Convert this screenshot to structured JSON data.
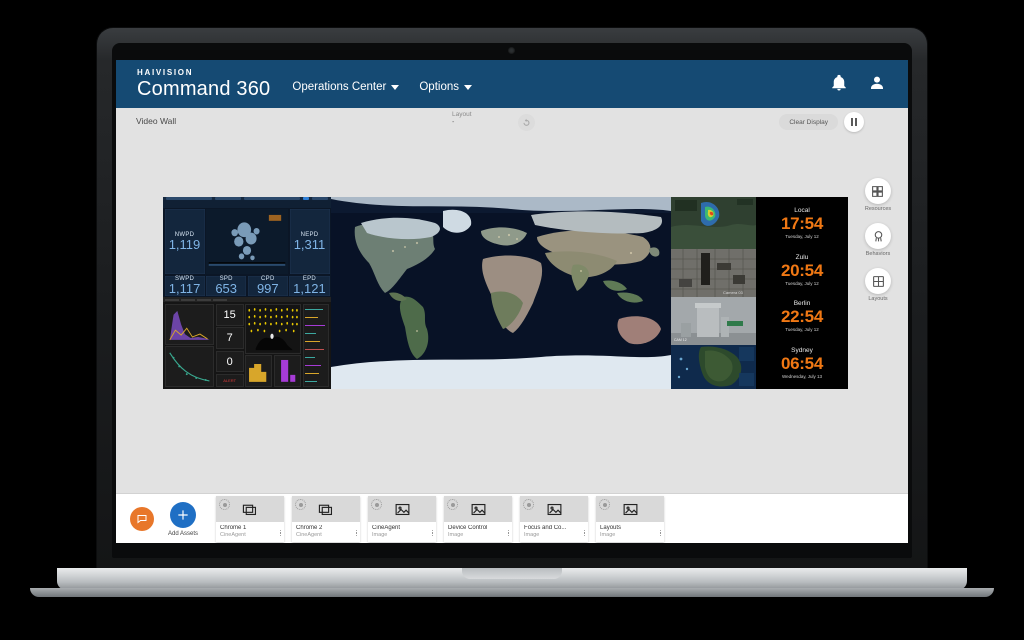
{
  "header": {
    "brand_top": "HAIVISION",
    "brand_main": "Command 360",
    "nav": [
      {
        "label": "Operations Center",
        "icon": "chevron-down-icon"
      },
      {
        "label": "Options",
        "icon": "chevron-down-icon"
      }
    ],
    "notifications_icon": "bell-icon",
    "account_icon": "user-icon"
  },
  "toolbar": {
    "title": "Video Wall",
    "layout_label": "Layout",
    "layout_value": "-",
    "refresh_icon": "refresh-icon",
    "clear_display_label": "Clear Display",
    "pause_icon": "pause-icon"
  },
  "rail": {
    "items": [
      {
        "label": "Resources",
        "icon": "resources-grid-icon"
      },
      {
        "label": "Behaviors",
        "icon": "behaviors-icon"
      },
      {
        "label": "Layouts",
        "icon": "layouts-grid-icon"
      }
    ]
  },
  "wall": {
    "dashboard": {
      "metrics": [
        {
          "label": "NWPD",
          "value": "1,119"
        },
        {
          "label": "NEPD",
          "value": "1,311"
        },
        {
          "label": "SWPD",
          "value": "1,117"
        },
        {
          "label": "SPD",
          "value": "653"
        },
        {
          "label": "CPD",
          "value": "997"
        },
        {
          "label": "EPD",
          "value": "1,121"
        }
      ],
      "analytics_numbers": [
        "15",
        "7",
        "0"
      ]
    },
    "map": {
      "description": "satellite world map"
    },
    "feeds": [
      {
        "name": "weather-radar-feed"
      },
      {
        "name": "aerial-grayscale-feed"
      },
      {
        "name": "building-camera-feed"
      },
      {
        "name": "regional-map-feed"
      }
    ],
    "clocks": [
      {
        "city": "Local",
        "time": "17:54",
        "date": "Tuesday, July 12"
      },
      {
        "city": "Zulu",
        "time": "20:54",
        "date": "Tuesday, July 12"
      },
      {
        "city": "Berlin",
        "time": "22:54",
        "date": "Tuesday, July 12"
      },
      {
        "city": "Sydney",
        "time": "06:54",
        "date": "Wednesday, July 13"
      }
    ],
    "clock_color": "#f07814"
  },
  "tray": {
    "chat_icon": "chat-bubble-icon",
    "add_label": "Add Assets",
    "add_icon": "plus-icon",
    "cards": [
      {
        "name": "Chrome 1",
        "type": "CineAgent",
        "icon": "windows-stack-icon"
      },
      {
        "name": "Chrome 2",
        "type": "CineAgent",
        "icon": "windows-stack-icon"
      },
      {
        "name": "CineAgent",
        "type": "Image",
        "icon": "image-icon"
      },
      {
        "name": "Device Control",
        "type": "Image",
        "icon": "image-icon"
      },
      {
        "name": "Focus and Co...",
        "type": "Image",
        "icon": "image-icon"
      },
      {
        "name": "Layouts",
        "type": "Image",
        "icon": "image-icon"
      }
    ]
  },
  "colors": {
    "brand_navy": "#154a73",
    "accent_blue": "#1f6fc4",
    "accent_orange": "#e8772a"
  }
}
